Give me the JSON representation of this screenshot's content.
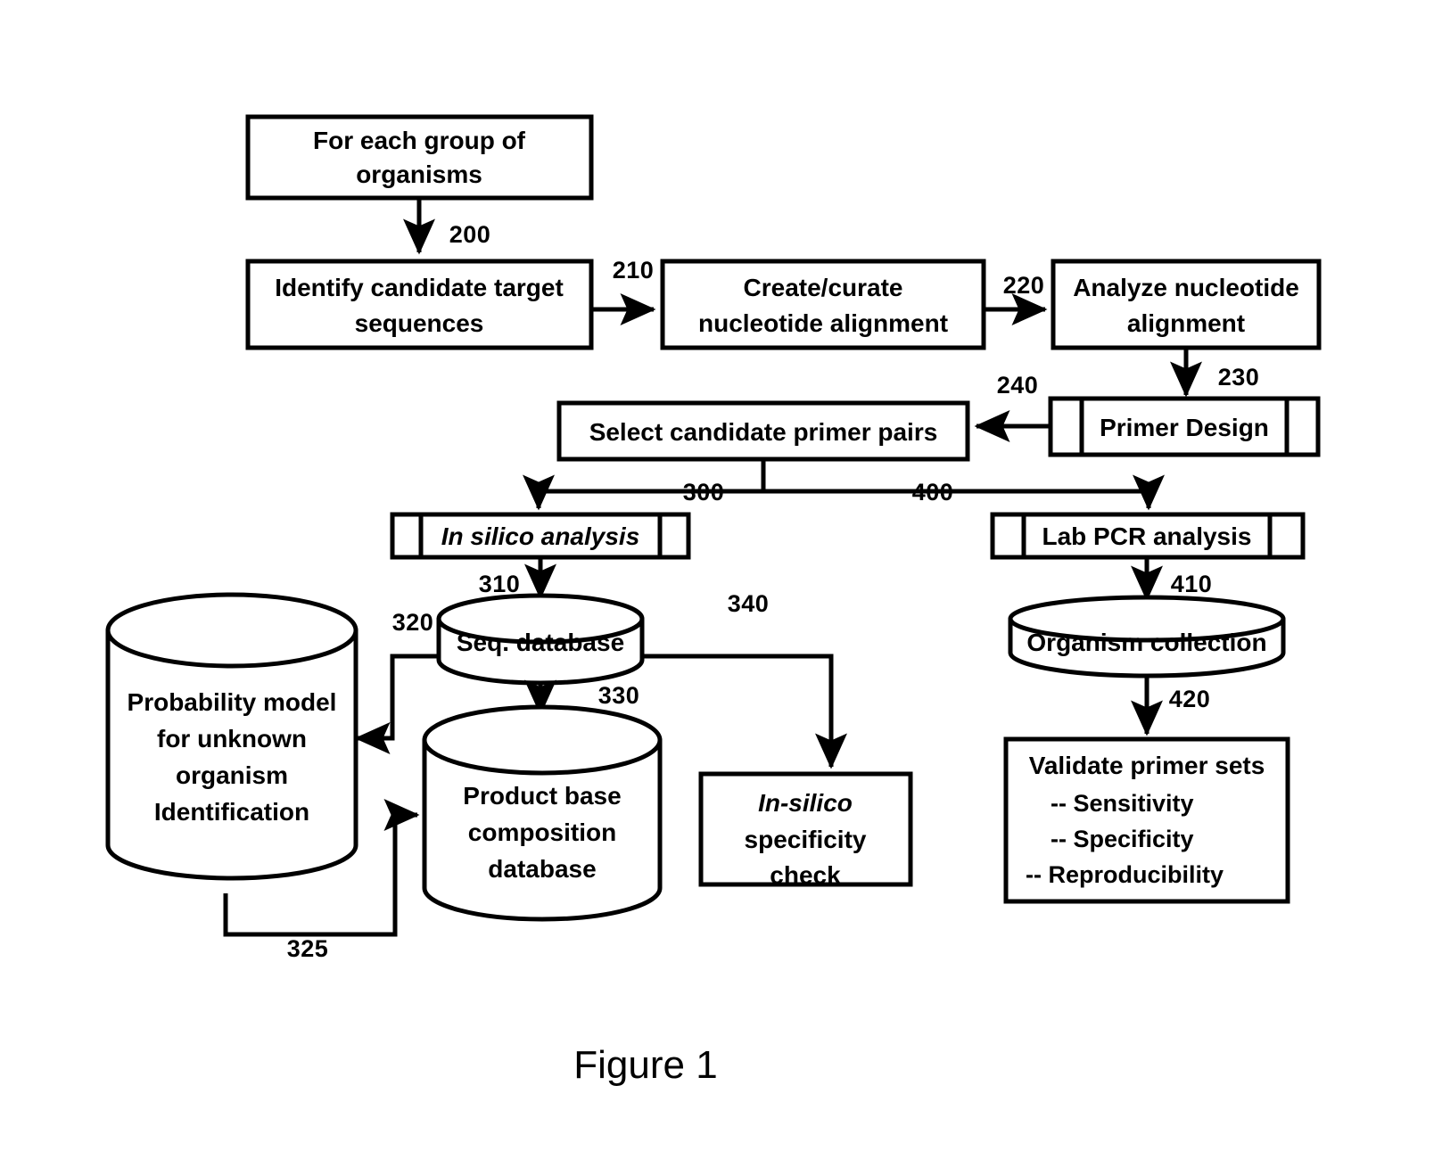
{
  "figure": {
    "caption": "Figure 1"
  },
  "nodes": {
    "for_each_group": {
      "line1": "For each group of",
      "line2": "organisms"
    },
    "identify_candidate": {
      "line1": "Identify candidate target",
      "line2": "sequences"
    },
    "create_curate": {
      "line1": "Create/curate",
      "line2": "nucleotide alignment"
    },
    "analyze_alignment": {
      "line1": "Analyze nucleotide",
      "line2": "alignment"
    },
    "primer_design": {
      "label": "Primer Design"
    },
    "select_primer_pairs": {
      "label": "Select candidate primer pairs"
    },
    "in_silico_analysis": {
      "label": "In silico analysis"
    },
    "lab_pcr_analysis": {
      "label": "Lab PCR analysis"
    },
    "seq_database": {
      "label": "Seq. database"
    },
    "probability_model": {
      "line1": "Probability model",
      "line2": "for unknown",
      "line3": "organism",
      "line4": "Identification"
    },
    "product_base_db": {
      "line1": "Product base",
      "line2": "composition",
      "line3": "database"
    },
    "in_silico_specificity": {
      "line1": "In-silico",
      "line2": "specificity",
      "line3": "check"
    },
    "organism_collection": {
      "label": "Organism collection"
    },
    "validate_primer_sets": {
      "title": "Validate primer sets",
      "bullets": [
        "-- Sensitivity",
        "-- Specificity",
        "-- Reproducibility"
      ]
    }
  },
  "reference_numerals": {
    "n200": "200",
    "n210": "210",
    "n220": "220",
    "n230": "230",
    "n240": "240",
    "n300": "300",
    "n310": "310",
    "n320": "320",
    "n325": "325",
    "n330": "330",
    "n340": "340",
    "n400": "400",
    "n410": "410",
    "n420": "420"
  },
  "colors": {
    "stroke": "#000000",
    "fill": "#ffffff",
    "background": "#ffffff"
  }
}
